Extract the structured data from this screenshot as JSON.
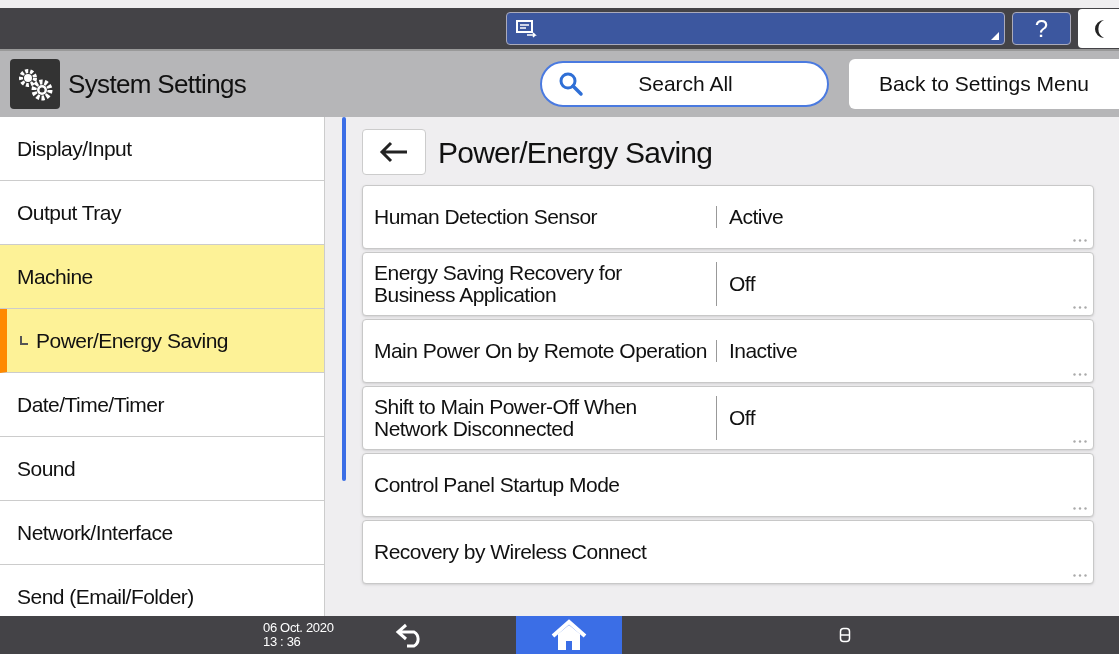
{
  "top_bar": {
    "help_label": "?"
  },
  "header": {
    "title": "System Settings",
    "search_button": "Search All",
    "back_button": "Back to Settings Menu"
  },
  "sidebar": {
    "items": [
      {
        "label": "Display/Input",
        "selected": false
      },
      {
        "label": "Output Tray",
        "selected": false
      },
      {
        "label": "Machine",
        "selected": false,
        "expanded": true,
        "children": [
          {
            "label": "Power/Energy Saving",
            "selected": true
          }
        ]
      },
      {
        "label": "Date/Time/Timer",
        "selected": false
      },
      {
        "label": "Sound",
        "selected": false
      },
      {
        "label": "Network/Interface",
        "selected": false
      },
      {
        "label": "Send (Email/Folder)",
        "selected": false
      }
    ]
  },
  "content": {
    "title": "Power/Energy Saving",
    "settings": [
      {
        "label": "Human Detection Sensor",
        "value": "Active"
      },
      {
        "label": "Energy Saving Recovery for Business Application",
        "value": "Off"
      },
      {
        "label": "Main Power On by Remote Operation",
        "value": "Inactive"
      },
      {
        "label": "Shift to Main Power-Off When Network Disconnected",
        "value": "Off"
      },
      {
        "label": "Control Panel Startup Mode"
      },
      {
        "label": "Recovery by Wireless Connect"
      }
    ]
  },
  "bottom_bar": {
    "date": "06 Oct. 2020",
    "time": "13 : 36"
  }
}
